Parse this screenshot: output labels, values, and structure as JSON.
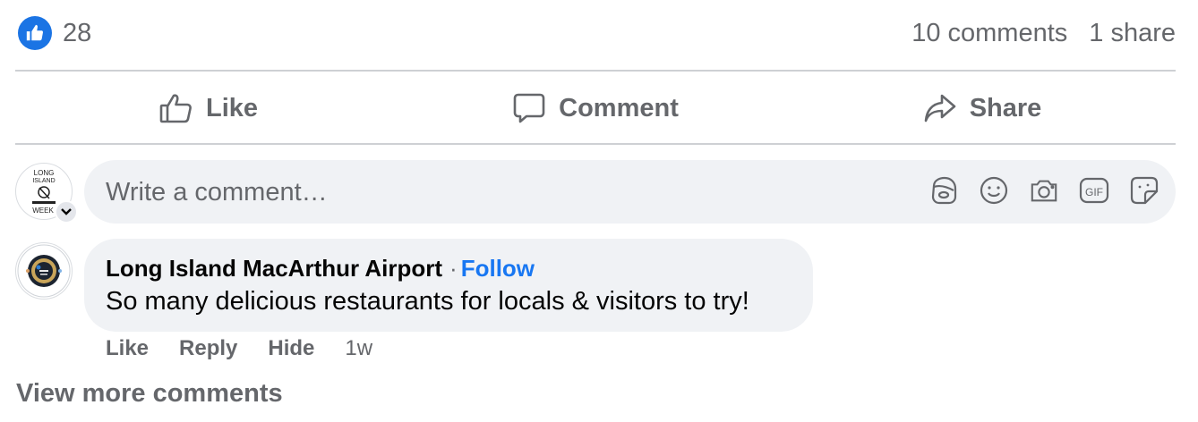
{
  "reactions": {
    "like_count": "28",
    "comments_count": "10 comments",
    "shares_count": "1 share"
  },
  "actions": {
    "like_label": "Like",
    "comment_label": "Comment",
    "share_label": "Share"
  },
  "composer": {
    "placeholder": "Write a comment…",
    "avatar_text_line1": "LONG",
    "avatar_text_line2": "ISLAND",
    "avatar_text_line3": "WEEK",
    "icons": [
      "avatar-sticker-icon",
      "emoji-icon",
      "camera-icon",
      "gif-icon",
      "sticker-icon"
    ],
    "gif_label": "GIF"
  },
  "comment": {
    "author": "Long Island MacArthur Airport",
    "separator": "·",
    "follow_label": "Follow",
    "text": "So many delicious restaurants for locals & visitors to try!",
    "like_label": "Like",
    "reply_label": "Reply",
    "hide_label": "Hide",
    "time": "1w"
  },
  "view_more_label": "View more comments",
  "colors": {
    "accent": "#1877f2",
    "like_badge": "#1b74e4",
    "secondary_text": "#65676b",
    "bubble_bg": "#f0f2f5",
    "divider": "#ced0d4"
  }
}
